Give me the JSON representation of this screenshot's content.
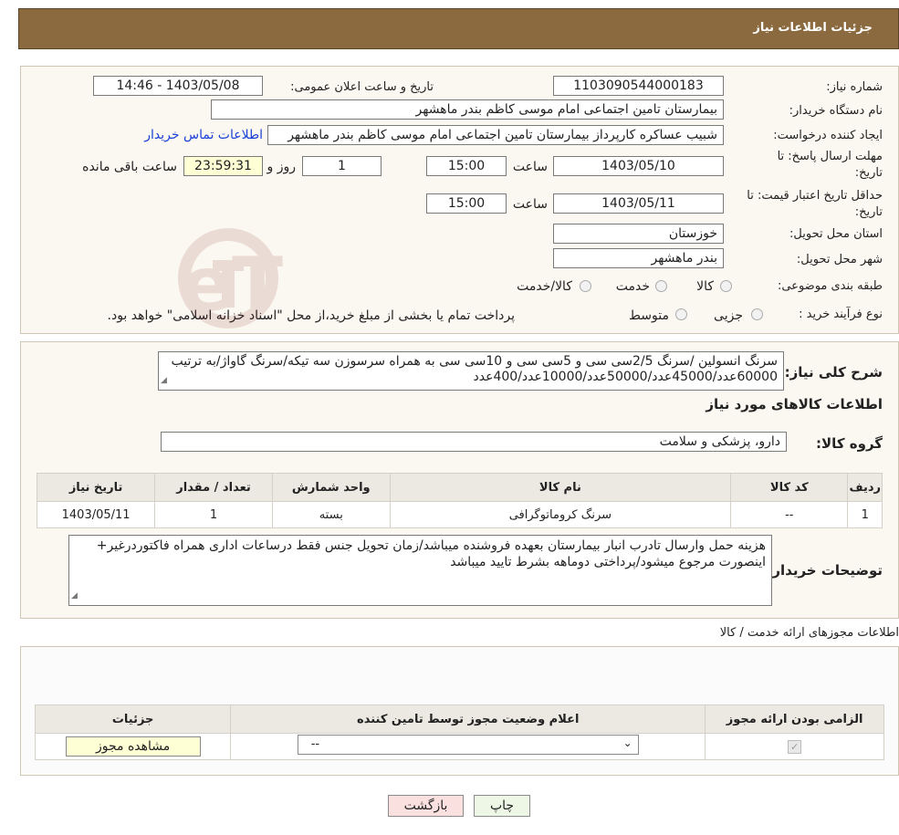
{
  "header": {
    "title": "جزئیات اطلاعات نیاز"
  },
  "info": {
    "need_number_label": "شماره نیاز:",
    "need_number": "1103090544000183",
    "announce_label": "تاریخ و ساعت اعلان عمومی:",
    "announce_value": "1403/05/08 - 14:46",
    "buyer_label": "نام دستگاه خریدار:",
    "buyer_value": "بیمارستان تامین اجتماعی امام موسی کاظم بندر ماهشهر",
    "creator_label": "ایجاد کننده درخواست:",
    "creator_value": "شبیب عساکره کارپرداز بیمارستان تامین اجتماعی امام موسی کاظم بندر ماهشهر",
    "contact_link": "اطلاعات تماس خریدار",
    "deadline_label_1": "مهلت ارسال پاسخ: تا",
    "deadline_label_2": "تاریخ:",
    "deadline_date": "1403/05/10",
    "time_label": "ساعت",
    "deadline_time": "15:00",
    "days_value": "1",
    "days_label": "روز و",
    "remaining_value": "23:59:31",
    "remaining_label": "ساعت باقی مانده",
    "validity_label_1": "حداقل تاریخ اعتبار قیمت: تا",
    "validity_label_2": "تاریخ:",
    "validity_date": "1403/05/11",
    "validity_time": "15:00",
    "province_label": "استان محل تحویل:",
    "province_value": "خوزستان",
    "city_label": "شهر محل تحویل:",
    "city_value": "بندر ماهشهر",
    "category_label": "طبقه بندی موضوعی:",
    "category_options": [
      "کالا",
      "خدمت",
      "کالا/خدمت"
    ],
    "process_label": "نوع فرآیند خرید :",
    "process_options": [
      "جزیی",
      "متوسط"
    ],
    "process_note": "پرداخت تمام یا بخشی از مبلغ خرید،از محل \"اسناد خزانه اسلامی\" خواهد بود."
  },
  "summary": {
    "label": "شرح کلی نیاز:",
    "text": "سرنگ انسولین /سرنگ 2/5سی سی و 5سی سی و 10سی سی به همراه سرسوزن سه تیکه/سرنگ گاواژ/به ترتیب 60000عدد/45000عدد/50000عدد/10000عدد/400عدد",
    "goods_info_title": "اطلاعات کالاهای مورد نیاز",
    "group_label": "گروه کالا:",
    "group_value": "دارو، پزشکی و سلامت"
  },
  "goods_table": {
    "headers": [
      "ردیف",
      "کد کالا",
      "نام کالا",
      "واحد شمارش",
      "تعداد / مقدار",
      "تاریخ نیاز"
    ],
    "rows": [
      [
        "1",
        "--",
        "سرنگ کروماتوگرافی",
        "بسته",
        "1",
        "1403/05/11"
      ]
    ]
  },
  "buyer_notes": {
    "label": "توضیحات خریدار:",
    "line1": "هزینه حمل وارسال تادرب انبار بیمارستان بعهده فروشنده میباشد/زمان تحویل جنس فقط درساعات اداری همراه فاکتوردرغیر+",
    "line2": "اینصورت مرجوع میشود/پرداختی دوماهه بشرط تایید میباشد"
  },
  "permits": {
    "title": "اطلاعات مجوزهای ارائه خدمت / کالا",
    "headers": [
      "الزامی بودن ارائه مجوز",
      "اعلام وضعیت مجوز توسط تامین کننده",
      "جزئیات"
    ],
    "select_value": "--",
    "view_button": "مشاهده مجوز"
  },
  "actions": {
    "print": "چاپ",
    "back": "بازگشت"
  },
  "watermark": "AriaTender.neT"
}
